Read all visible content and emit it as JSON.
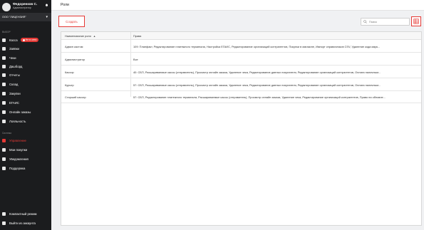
{
  "user": {
    "name": "Федоренков С.",
    "role": "Администратор"
  },
  "org": {
    "label": "ООО \"ЛИЦЕНЗИЯ\""
  },
  "sidebar": {
    "section_main": "ВЫБОР",
    "section_system": "Система",
    "items": [
      {
        "label": "Касса",
        "icon": "cash-register-icon",
        "badge": "Не в сети"
      },
      {
        "label": "Заявки",
        "icon": "requests-icon"
      },
      {
        "label": "Чеки",
        "icon": "receipt-icon"
      },
      {
        "label": "Дашборд",
        "icon": "dashboard-icon"
      },
      {
        "label": "Отчеты",
        "icon": "reports-icon"
      },
      {
        "label": "Склад",
        "icon": "warehouse-icon"
      },
      {
        "label": "Закупки",
        "icon": "purchases-icon"
      },
      {
        "label": "ЕГАИС",
        "icon": "egais-icon"
      },
      {
        "label": "Онлайн заказы",
        "icon": "online-orders-icon"
      },
      {
        "label": "Лояльность",
        "icon": "loyalty-icon"
      }
    ],
    "system_items": [
      {
        "label": "Управление",
        "icon": "management-icon",
        "active": true
      },
      {
        "label": "Мои покупки",
        "icon": "my-purchases-icon"
      },
      {
        "label": "Уведомления",
        "icon": "notifications-icon"
      },
      {
        "label": "Поддержка",
        "icon": "support-icon"
      }
    ],
    "bottom_items": [
      {
        "label": "Компактный режим",
        "icon": "compact-mode-icon"
      },
      {
        "label": "Выйти из аккаунта",
        "icon": "logout-icon"
      }
    ]
  },
  "page": {
    "title": "Роли"
  },
  "toolbar": {
    "create_label": "Создать",
    "search_placeholder": "Поиск"
  },
  "table": {
    "columns": [
      "Наименование роли",
      "Права"
    ],
    "rows": [
      {
        "name": "Админ кастом",
        "rights": "109: Планфакт, Редактирование платежного терминала, Настройка ЕГАИС, Редактирование организаций контрагентов, Покупки в магазине, Импорт справочников CSV, Удаление кода марк..."
      },
      {
        "name": "Администратор",
        "rights": "Все"
      },
      {
        "name": "Кассир",
        "rights": "40: СБП, Расшариваемые кассы (отправитель), Просмотр онлайн заказа, Удаление чека, Редактирование данных покупателя, Редактирование организаций контрагентов, Оплата наличным..."
      },
      {
        "name": "Курьер",
        "rights": "57: СБП, Расшариваемые кассы (отправитель), Просмотр онлайн заказа, Удаление чека, Редактирование данных покупателя, Редактирование организаций контрагентов, Оплата наличным..."
      },
      {
        "name": "Старший кассир",
        "rights": "57: СБП, Редактирование платежного терминала, Расшариваемые кассы (отправитель), Просмотр онлайн заказа, Удаление чека, Редактирование организаций контрагентов, Право на обновле..."
      }
    ]
  },
  "colors": {
    "accent": "#e53935",
    "sidebar_bg": "#1b1c1e"
  }
}
